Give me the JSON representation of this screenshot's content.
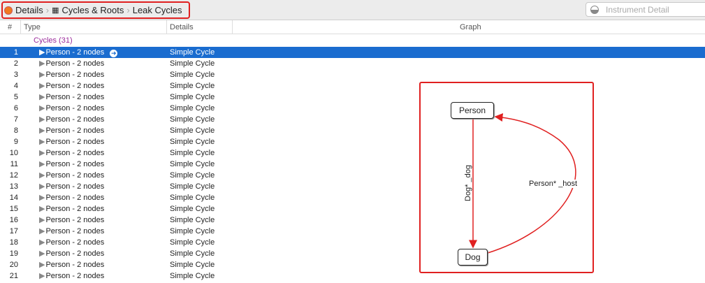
{
  "breadcrumb": [
    "Details",
    "Cycles & Roots",
    "Leak Cycles"
  ],
  "search": {
    "placeholder": "Instrument Detail"
  },
  "columns": {
    "num": "#",
    "type": "Type",
    "details": "Details",
    "graph": "Graph"
  },
  "group": "Cycles (31)",
  "rows": [
    {
      "n": "1",
      "type": "Person - 2 nodes",
      "details": "Simple Cycle"
    },
    {
      "n": "2",
      "type": "Person - 2 nodes",
      "details": "Simple Cycle"
    },
    {
      "n": "3",
      "type": "Person - 2 nodes",
      "details": "Simple Cycle"
    },
    {
      "n": "4",
      "type": "Person - 2 nodes",
      "details": "Simple Cycle"
    },
    {
      "n": "5",
      "type": "Person - 2 nodes",
      "details": "Simple Cycle"
    },
    {
      "n": "6",
      "type": "Person - 2 nodes",
      "details": "Simple Cycle"
    },
    {
      "n": "7",
      "type": "Person - 2 nodes",
      "details": "Simple Cycle"
    },
    {
      "n": "8",
      "type": "Person - 2 nodes",
      "details": "Simple Cycle"
    },
    {
      "n": "9",
      "type": "Person - 2 nodes",
      "details": "Simple Cycle"
    },
    {
      "n": "10",
      "type": "Person - 2 nodes",
      "details": "Simple Cycle"
    },
    {
      "n": "11",
      "type": "Person - 2 nodes",
      "details": "Simple Cycle"
    },
    {
      "n": "12",
      "type": "Person - 2 nodes",
      "details": "Simple Cycle"
    },
    {
      "n": "13",
      "type": "Person - 2 nodes",
      "details": "Simple Cycle"
    },
    {
      "n": "14",
      "type": "Person - 2 nodes",
      "details": "Simple Cycle"
    },
    {
      "n": "15",
      "type": "Person - 2 nodes",
      "details": "Simple Cycle"
    },
    {
      "n": "16",
      "type": "Person - 2 nodes",
      "details": "Simple Cycle"
    },
    {
      "n": "17",
      "type": "Person - 2 nodes",
      "details": "Simple Cycle"
    },
    {
      "n": "18",
      "type": "Person - 2 nodes",
      "details": "Simple Cycle"
    },
    {
      "n": "19",
      "type": "Person - 2 nodes",
      "details": "Simple Cycle"
    },
    {
      "n": "20",
      "type": "Person - 2 nodes",
      "details": "Simple Cycle"
    },
    {
      "n": "21",
      "type": "Person - 2 nodes",
      "details": "Simple Cycle"
    }
  ],
  "graph": {
    "node_a": "Person",
    "node_b": "Dog",
    "edge_ab": "Dog* _dog",
    "edge_ba": "Person* _host"
  }
}
